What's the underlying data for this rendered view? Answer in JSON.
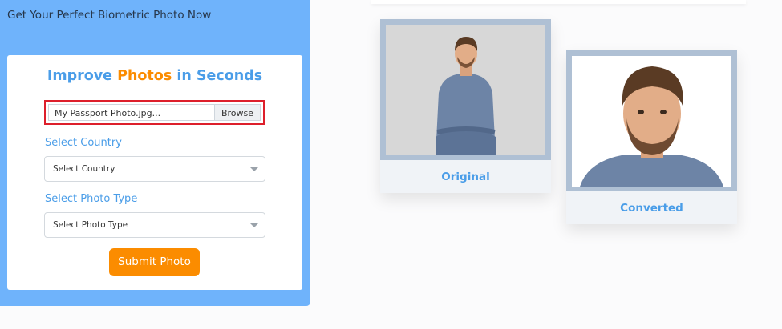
{
  "tagline": "Get Your Perfect Biometric Photo Now",
  "form": {
    "heading": {
      "part1": "Improve",
      "part2": "Photos",
      "part3": "in Seconds"
    },
    "file": {
      "value": "My Passport Photo.jpg...",
      "browse_label": "Browse"
    },
    "country": {
      "label": "Select Country",
      "selected": "Select Country"
    },
    "photo_type": {
      "label": "Select Photo Type",
      "selected": "Select Photo Type"
    },
    "submit_label": "Submit Photo"
  },
  "samples": {
    "original_caption": "Original",
    "converted_caption": "Converted"
  },
  "colors": {
    "panel": "#6fb3fb",
    "accent_blue": "#4a9de8",
    "accent_orange": "#fb8c00",
    "highlight": "#dd1f2b",
    "frame": "#afc0d4"
  }
}
